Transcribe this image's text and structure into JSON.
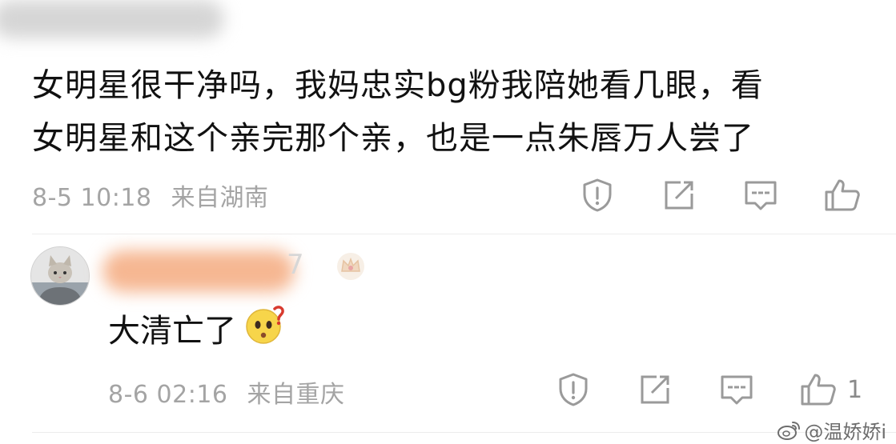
{
  "comment": {
    "text_line1": "女明星很干净吗，我妈忠实bg粉我陪她看几眼，看",
    "text_line2": "女明星和这个亲完那个亲，也是一点朱唇万人尝了",
    "timestamp": "8-5 10:18",
    "location": "来自湖南",
    "actions": [
      "report-icon",
      "share-icon",
      "comment-icon",
      "like-icon"
    ]
  },
  "reply": {
    "name_suffix": "7",
    "text": "大清亡了",
    "emoji": "confused-face-emoji",
    "timestamp": "8-6 02:16",
    "location": "来自重庆",
    "like_count": "1",
    "actions": [
      "report-icon",
      "share-icon",
      "comment-icon",
      "like-icon"
    ]
  },
  "watermark": {
    "text": "@温娇娇i"
  },
  "colors": {
    "text": "#111111",
    "meta": "#a4a4a4",
    "icon": "#9a9a9a",
    "redacted_orange": "#f6b792"
  }
}
